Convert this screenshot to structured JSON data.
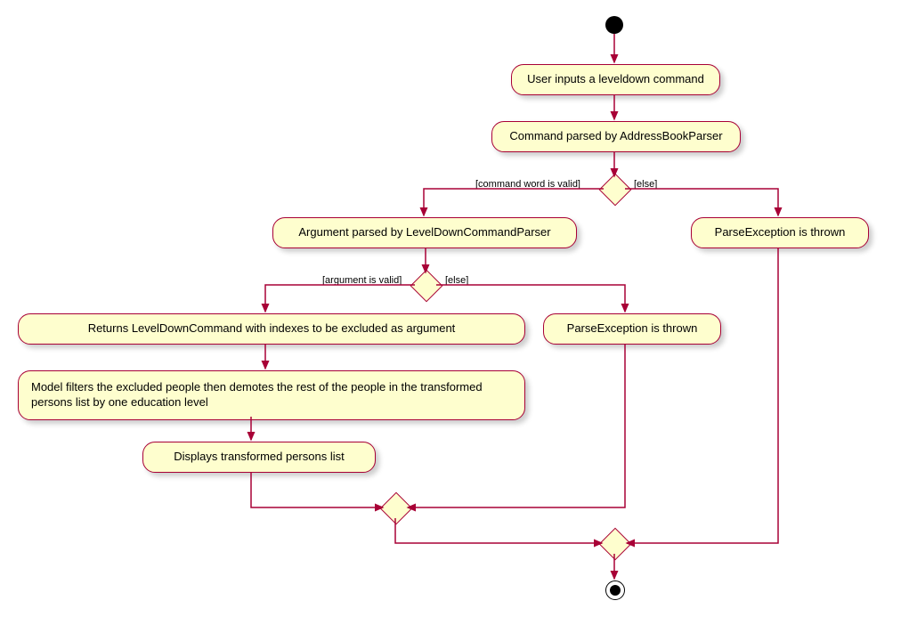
{
  "nodes": {
    "n1": "User inputs a leveldown command",
    "n2": "Command parsed by AddressBookParser",
    "n3": "Argument parsed by LevelDownCommandParser",
    "n4": "ParseException is thrown",
    "n5": "Returns LevelDownCommand with indexes to be excluded as argument",
    "n6": "ParseException is thrown",
    "n7": "Model filters the excluded people then demotes the rest of the people in the transformed persons list by one education level",
    "n8": "Displays transformed persons list"
  },
  "guards": {
    "g1": "[command word is valid]",
    "g2": "[else]",
    "g3": "[argument is valid]",
    "g4": "[else]"
  }
}
